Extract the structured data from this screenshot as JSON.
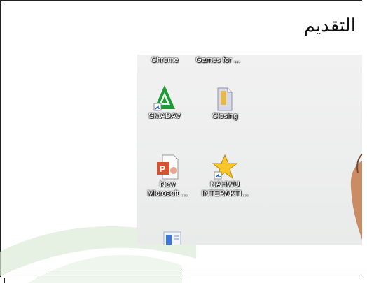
{
  "slide": {
    "heading": "التقديم"
  },
  "desktop": {
    "icons": [
      {
        "name": "chrome",
        "label": "Chrome"
      },
      {
        "name": "games",
        "label": "Games for ..."
      },
      {
        "name": "smadav",
        "label": "SMADAV"
      },
      {
        "name": "closing",
        "label": "Closing"
      },
      {
        "name": "new-ppt",
        "label_line1": "New",
        "label_line2": "Microsoft ..."
      },
      {
        "name": "nahwu",
        "label_line1": "NAHWU",
        "label_line2": "INTERAKTI..."
      }
    ]
  },
  "colors": {
    "smadav_green": "#1f9b3a",
    "ppt_orange": "#d35230",
    "star_yellow": "#f7c628",
    "watermark_green": "#cfe3cc"
  }
}
